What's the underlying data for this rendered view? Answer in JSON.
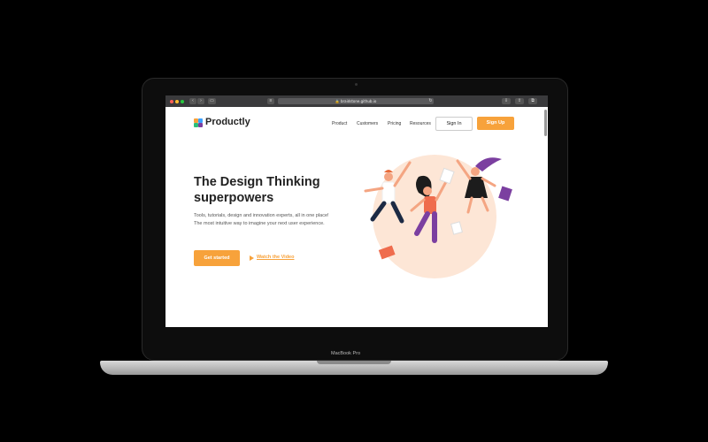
{
  "browser": {
    "url": "braidstone.github.io"
  },
  "site": {
    "brand": "Productly",
    "nav": [
      "Product",
      "Customers",
      "Pricing",
      "Resources"
    ],
    "signin_label": "Sign In",
    "signup_label": "Sign Up"
  },
  "hero": {
    "headline_line1": "The Design Thinking",
    "headline_line2": "superpowers",
    "subtext": "Tools, tutorials, design and innovation experts, all in one place! The most intuitive way to imagine your next user experience.",
    "primary_cta": "Get started",
    "secondary_cta": "Watch the Video"
  },
  "device": {
    "model_label": "MacBook Pro"
  },
  "colors": {
    "accent": "#f7a23b",
    "text_dark": "#222222",
    "peach_blob": "#fde6d6",
    "purple": "#7b3fa0"
  }
}
